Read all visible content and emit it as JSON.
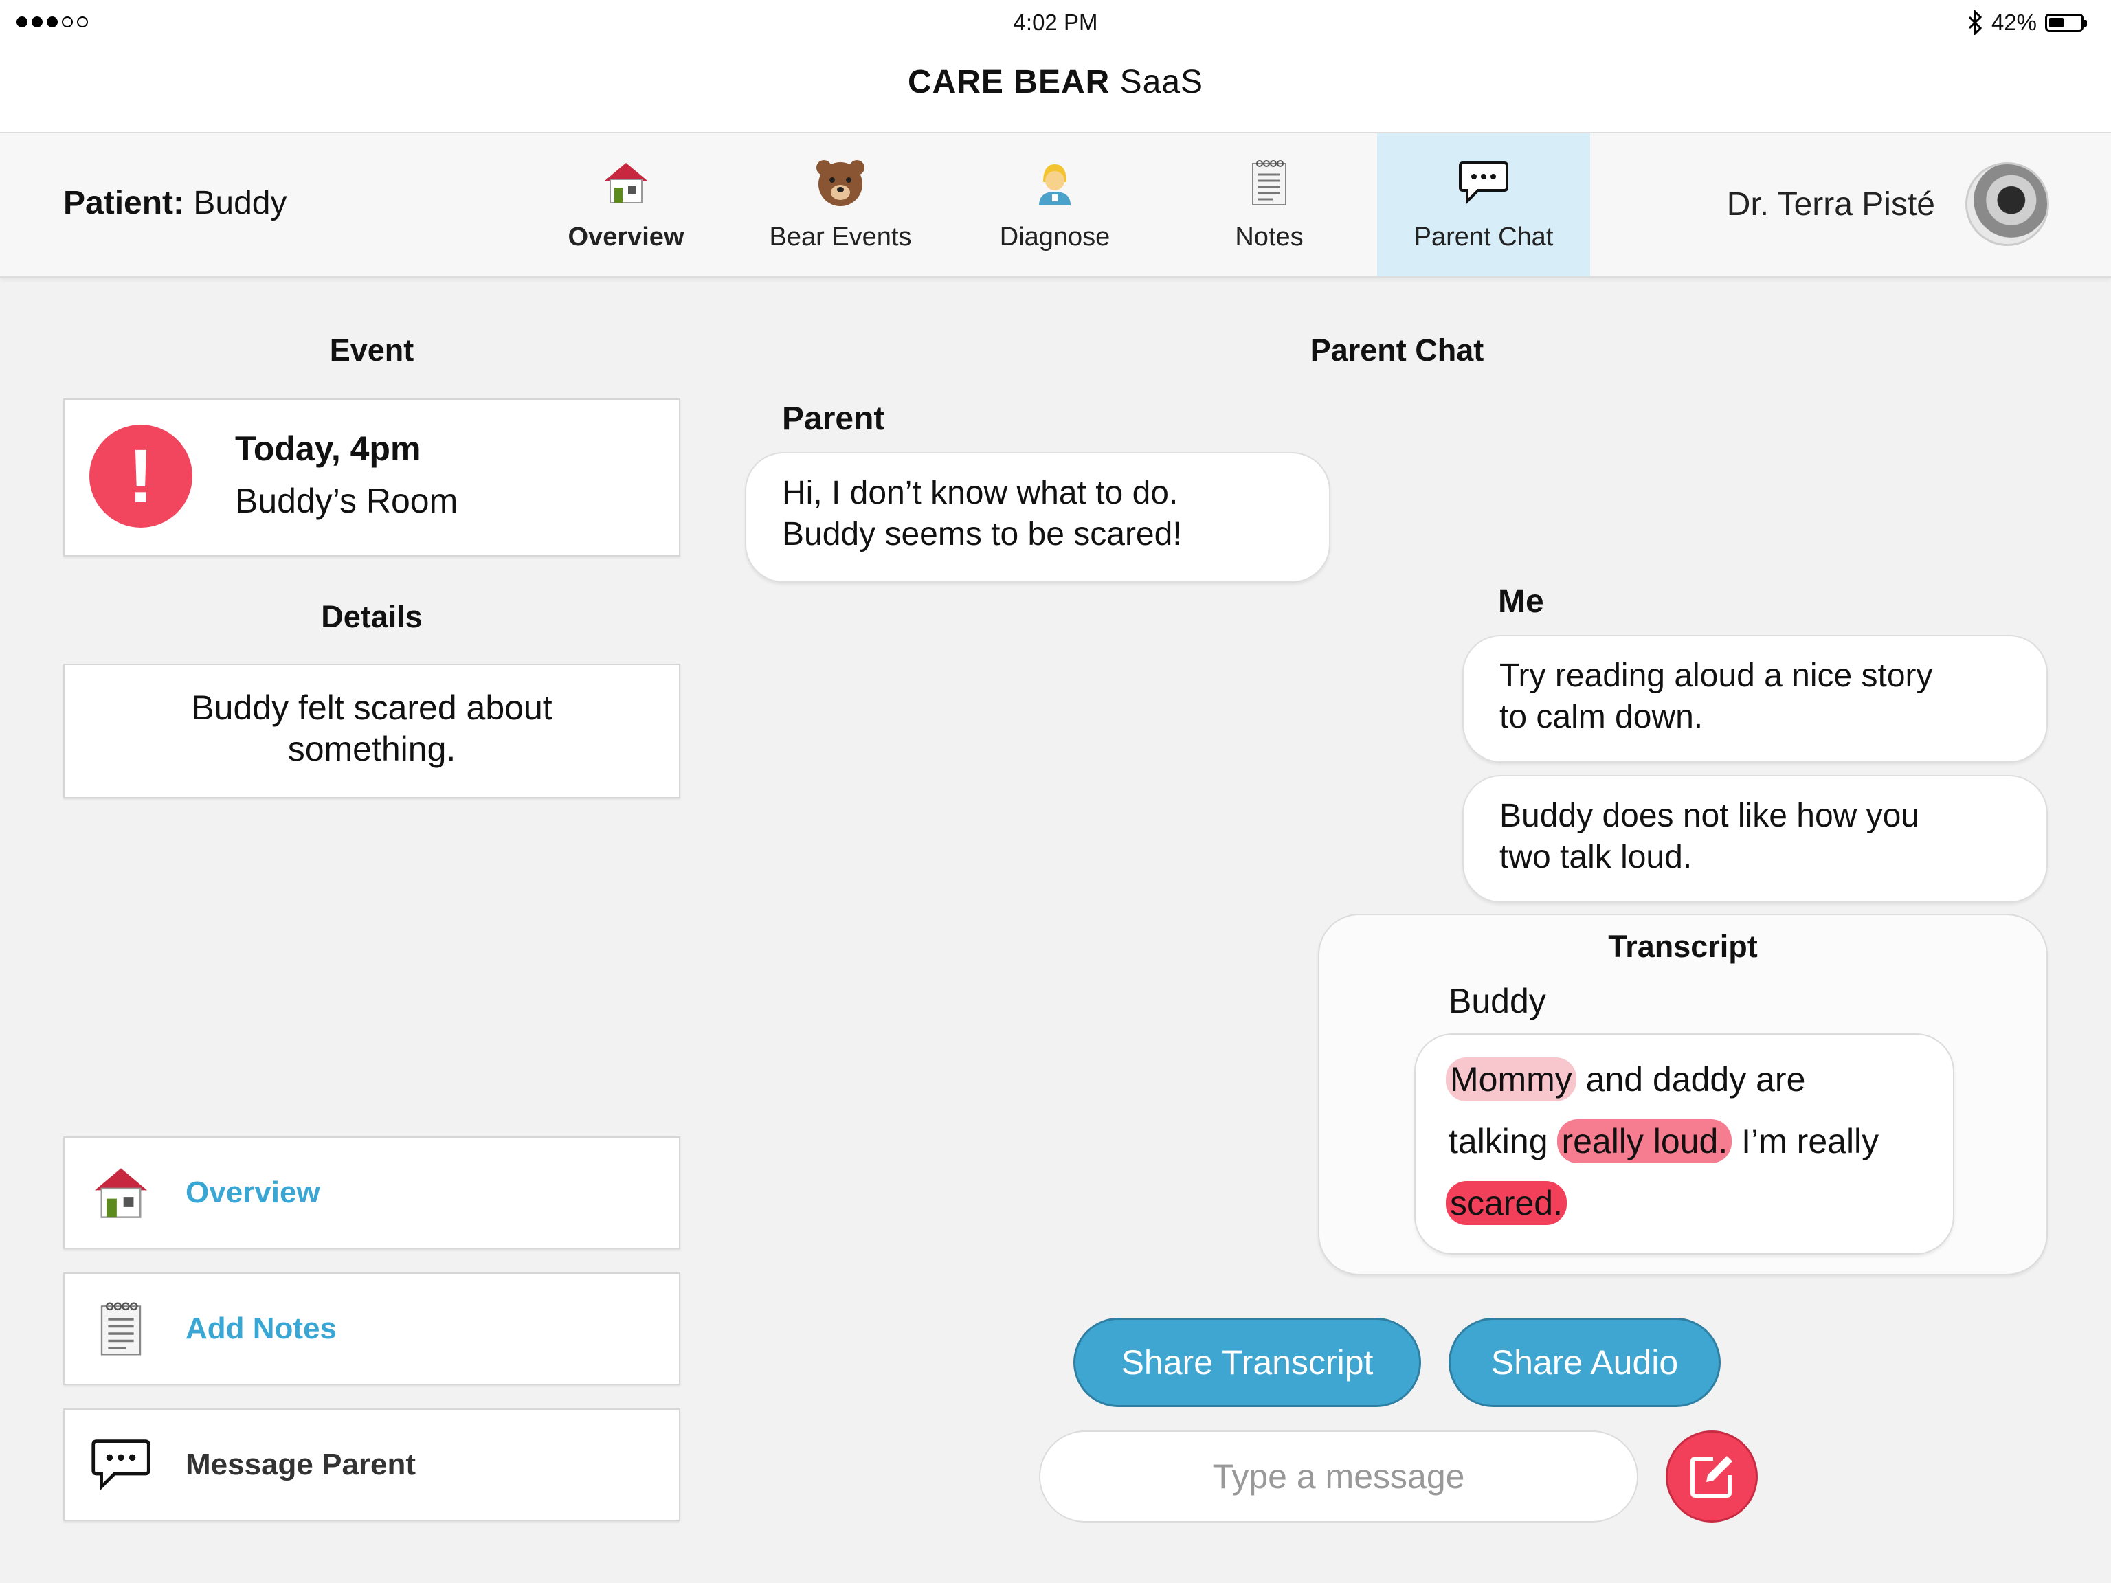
{
  "status_bar": {
    "time": "4:02 PM",
    "battery": "42%",
    "battery_level": 0.42
  },
  "app": {
    "title_bold": "CARE BEAR",
    "title_rest": "SaaS"
  },
  "patient": {
    "label": "Patient:",
    "name": "Buddy"
  },
  "tabs": [
    {
      "label": "Overview",
      "icon": "house-icon",
      "active": false
    },
    {
      "label": "Bear Events",
      "icon": "bear-icon",
      "active": false
    },
    {
      "label": "Diagnose",
      "icon": "nurse-icon",
      "active": false
    },
    {
      "label": "Notes",
      "icon": "notepad-icon",
      "active": false
    },
    {
      "label": "Parent Chat",
      "icon": "chat-bubble-icon",
      "active": true
    }
  ],
  "doctor": {
    "name": "Dr. Terra Pisté"
  },
  "event": {
    "heading": "Event",
    "time": "Today, 4pm",
    "place": "Buddy’s Room"
  },
  "details": {
    "heading": "Details",
    "line1": "Buddy felt scared about",
    "line2": "something."
  },
  "actions": [
    {
      "label": "Overview",
      "icon": "house-icon"
    },
    {
      "label": "Add Notes",
      "icon": "notepad-icon"
    },
    {
      "label": "Message Parent",
      "icon": "chat-bubble-icon"
    }
  ],
  "chat": {
    "heading": "Parent Chat",
    "parent_label": "Parent",
    "parent_message": {
      "line1": "Hi, I don’t know what to do.",
      "line2": "Buddy seems to be scared!"
    },
    "me_label": "Me",
    "me_messages": [
      {
        "line1": "Try reading aloud a nice story",
        "line2": "to calm down."
      },
      {
        "line1": "Buddy does not like how you",
        "line2": "two talk loud."
      }
    ],
    "transcript": {
      "heading": "Transcript",
      "speaker": "Buddy",
      "w1": "Mommy",
      "w2": "and daddy are",
      "w3": "talking",
      "w4": "really loud.",
      "w5": "I’m really",
      "w6": "scared."
    },
    "share_transcript": "Share Transcript",
    "share_audio": "Share Audio",
    "input_placeholder": "Type a message"
  },
  "colors": {
    "accent_blue": "#3ea6d1",
    "alert_red": "#f2465f",
    "active_tab": "#d7eef9"
  }
}
